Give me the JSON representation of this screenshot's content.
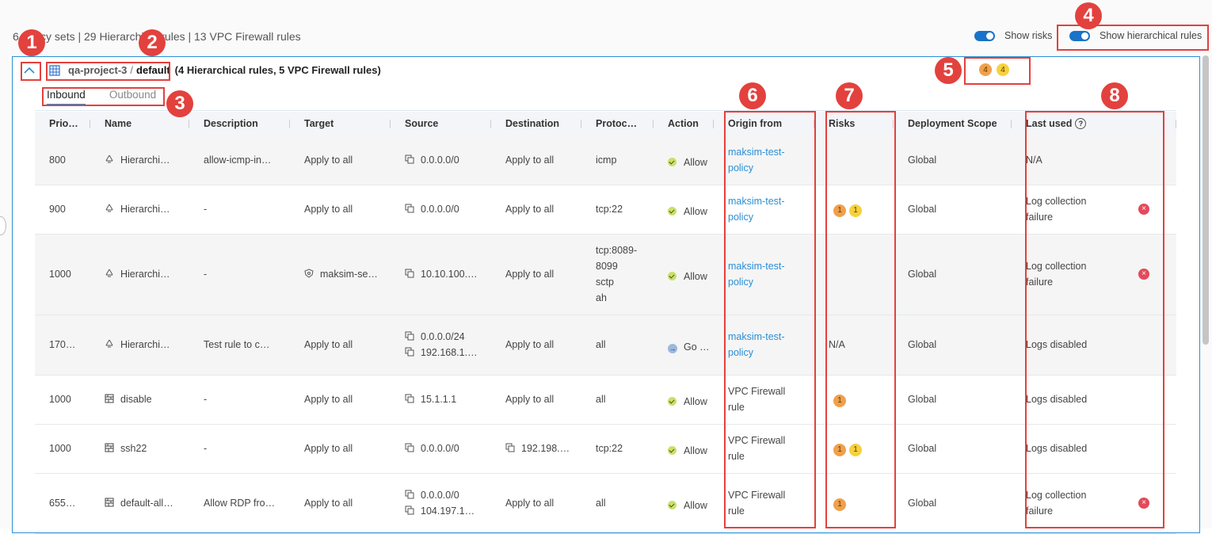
{
  "summary": "6 Policy sets | 29 Hierarchical rules | 13 VPC Firewall rules",
  "toggles": {
    "show_risks": "Show risks",
    "show_hierarchical": "Show hierarchical rules"
  },
  "breadcrumb": {
    "project": "qa-project-3",
    "separator": "/",
    "network": "default",
    "counts": "(4 Hierarchical rules, 5 VPC Firewall rules)"
  },
  "tabs": [
    {
      "label": "Inbound"
    },
    {
      "label": "Outbound"
    }
  ],
  "risk_summary": [
    "4",
    "4"
  ],
  "columns": [
    "Prio…",
    "Name",
    "Description",
    "Target",
    "Source",
    "Destination",
    "Protoc…",
    "Action",
    "Origin from",
    "Risks",
    "Deployment Scope",
    "Last used"
  ],
  "rows": [
    {
      "priority": "800",
      "name": "Hierarchi…",
      "description": "allow-icmp-in…",
      "target": "Apply to all",
      "source": [
        "0.0.0.0/0"
      ],
      "destination": "Apply to all",
      "protocol": [
        "icmp"
      ],
      "action": "Allow",
      "origin": [
        "maksim-test-",
        "policy"
      ],
      "risks": [],
      "scope": "Global",
      "last_used": [
        "N/A"
      ]
    },
    {
      "priority": "900",
      "name": "Hierarchi…",
      "description": "-",
      "target": "Apply to all",
      "source": [
        "0.0.0.0/0"
      ],
      "destination": "Apply to all",
      "protocol": [
        "tcp:22"
      ],
      "action": "Allow",
      "origin": [
        "maksim-test-",
        "policy"
      ],
      "risks": [
        "1",
        "1"
      ],
      "scope": "Global",
      "last_used": [
        "Log collection",
        "failure"
      ]
    },
    {
      "priority": "1000",
      "name": "Hierarchi…",
      "description": "-",
      "target": "maksim-se…",
      "source": [
        "10.10.100.…"
      ],
      "destination": "Apply to all",
      "protocol": [
        "tcp:8089-",
        "8099",
        "sctp",
        "ah"
      ],
      "action": "Allow",
      "origin": [
        "maksim-test-",
        "policy"
      ],
      "risks": [],
      "scope": "Global",
      "last_used": [
        "Log collection",
        "failure"
      ]
    },
    {
      "priority": "170…",
      "name": "Hierarchi…",
      "description": "Test rule to c…",
      "target": "Apply to all",
      "source": [
        "0.0.0.0/24",
        "192.168.1.…"
      ],
      "destination": "Apply to all",
      "protocol": [
        "all"
      ],
      "action": "Go …",
      "origin": [
        "maksim-test-",
        "policy"
      ],
      "risks_text": "N/A",
      "risks": [],
      "scope": "Global",
      "last_used": [
        "Logs disabled"
      ]
    },
    {
      "priority": "1000",
      "name": "disable",
      "description": "-",
      "target": "Apply to all",
      "source": [
        "15.1.1.1"
      ],
      "destination": "Apply to all",
      "protocol": [
        "all"
      ],
      "action": "Allow",
      "origin": [
        "VPC Firewall",
        "rule"
      ],
      "risks": [
        "1"
      ],
      "scope": "Global",
      "last_used": [
        "Logs disabled"
      ]
    },
    {
      "priority": "1000",
      "name": "ssh22",
      "description": "-",
      "target": "Apply to all",
      "source": [
        "0.0.0.0/0"
      ],
      "destination": "192.198.…",
      "protocol": [
        "tcp:22"
      ],
      "action": "Allow",
      "origin": [
        "VPC Firewall",
        "rule"
      ],
      "risks": [
        "1",
        "1"
      ],
      "scope": "Global",
      "last_used": [
        "Logs disabled"
      ]
    },
    {
      "priority": "655…",
      "name": "default-all…",
      "description": "Allow RDP fro…",
      "target": "Apply to all",
      "source": [
        "0.0.0.0/0",
        "104.197.1…"
      ],
      "destination": "Apply to all",
      "protocol": [
        "all"
      ],
      "action": "Allow",
      "origin": [
        "VPC Firewall",
        "rule"
      ],
      "risks": [
        "1"
      ],
      "scope": "Global",
      "last_used": [
        "Log collection",
        "failure"
      ]
    }
  ],
  "annotations": [
    "1",
    "2",
    "3",
    "4",
    "5",
    "6",
    "7",
    "8"
  ],
  "colors": {
    "accent": "#2a8fd6",
    "annotation": "#e3413d",
    "risk_high": "#f0a04b",
    "risk_medium": "#f7d13d",
    "allow": "#c9e06b",
    "fail": "#e34a5a"
  }
}
